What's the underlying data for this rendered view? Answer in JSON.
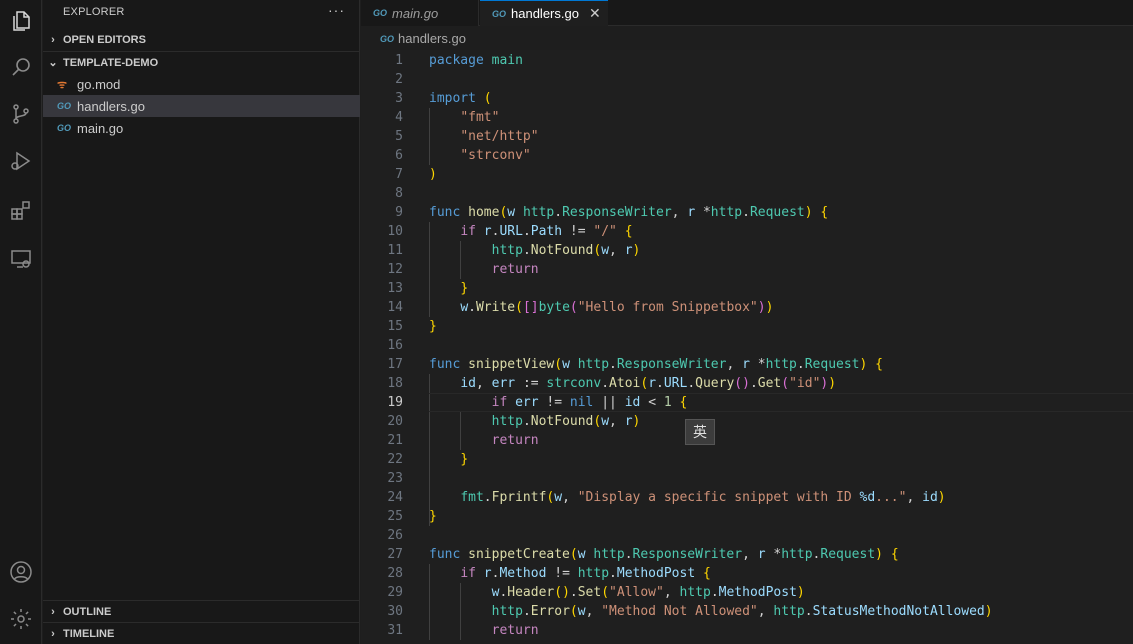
{
  "sidebar": {
    "title": "EXPLORER",
    "more": "···",
    "open_editors": "OPEN EDITORS",
    "project": "TEMPLATE-DEMO",
    "files": [
      "go.mod",
      "handlers.go",
      "main.go"
    ],
    "outline": "OUTLINE",
    "timeline": "TIMELINE"
  },
  "tabs": [
    {
      "label": "main.go",
      "icon": "go-file-icon"
    },
    {
      "label": "handlers.go",
      "icon": "go-file-icon",
      "active": true
    }
  ],
  "breadcrumb": "handlers.go",
  "ime_indicator": "英",
  "editor": {
    "current_line": 19,
    "line_numbers": [
      "1",
      "2",
      "3",
      "4",
      "5",
      "6",
      "7",
      "8",
      "9",
      "10",
      "11",
      "12",
      "13",
      "14",
      "15",
      "16",
      "17",
      "18",
      "19",
      "20",
      "21",
      "22",
      "23",
      "24",
      "25",
      "26",
      "27",
      "28",
      "29",
      "30",
      "31"
    ],
    "code": [
      "package main",
      "",
      "import (",
      "    \"fmt\"",
      "    \"net/http\"",
      "    \"strconv\"",
      ")",
      "",
      "func home(w http.ResponseWriter, r *http.Request) {",
      "    if r.URL.Path != \"/\" {",
      "        http.NotFound(w, r)",
      "        return",
      "    }",
      "    w.Write([]byte(\"Hello from Snippetbox\"))",
      "}",
      "",
      "func snippetView(w http.ResponseWriter, r *http.Request) {",
      "    id, err := strconv.Atoi(r.URL.Query().Get(\"id\"))",
      "        if err != nil || id < 1 {",
      "        http.NotFound(w, r)",
      "        return",
      "    }",
      "",
      "    fmt.Fprintf(w, \"Display a specific snippet with ID %d...\", id)",
      "}",
      "",
      "func snippetCreate(w http.ResponseWriter, r *http.Request) {",
      "    if r.Method != http.MethodPost {",
      "        w.Header().Set(\"Allow\", http.MethodPost)",
      "        http.Error(w, \"Method Not Allowed\", http.StatusMethodNotAllowed)",
      "        return"
    ]
  },
  "icons": [
    "files-icon",
    "search-icon",
    "source-control-icon",
    "run-debug-icon",
    "extensions-icon",
    "remote-explorer-icon",
    "account-icon",
    "settings-gear-icon"
  ],
  "colors": {
    "accent": "#0078d4",
    "keyword": "#569cd6",
    "control": "#c586c0",
    "function": "#dcdcaa",
    "string": "#ce9178",
    "type": "#4ec9b0"
  }
}
